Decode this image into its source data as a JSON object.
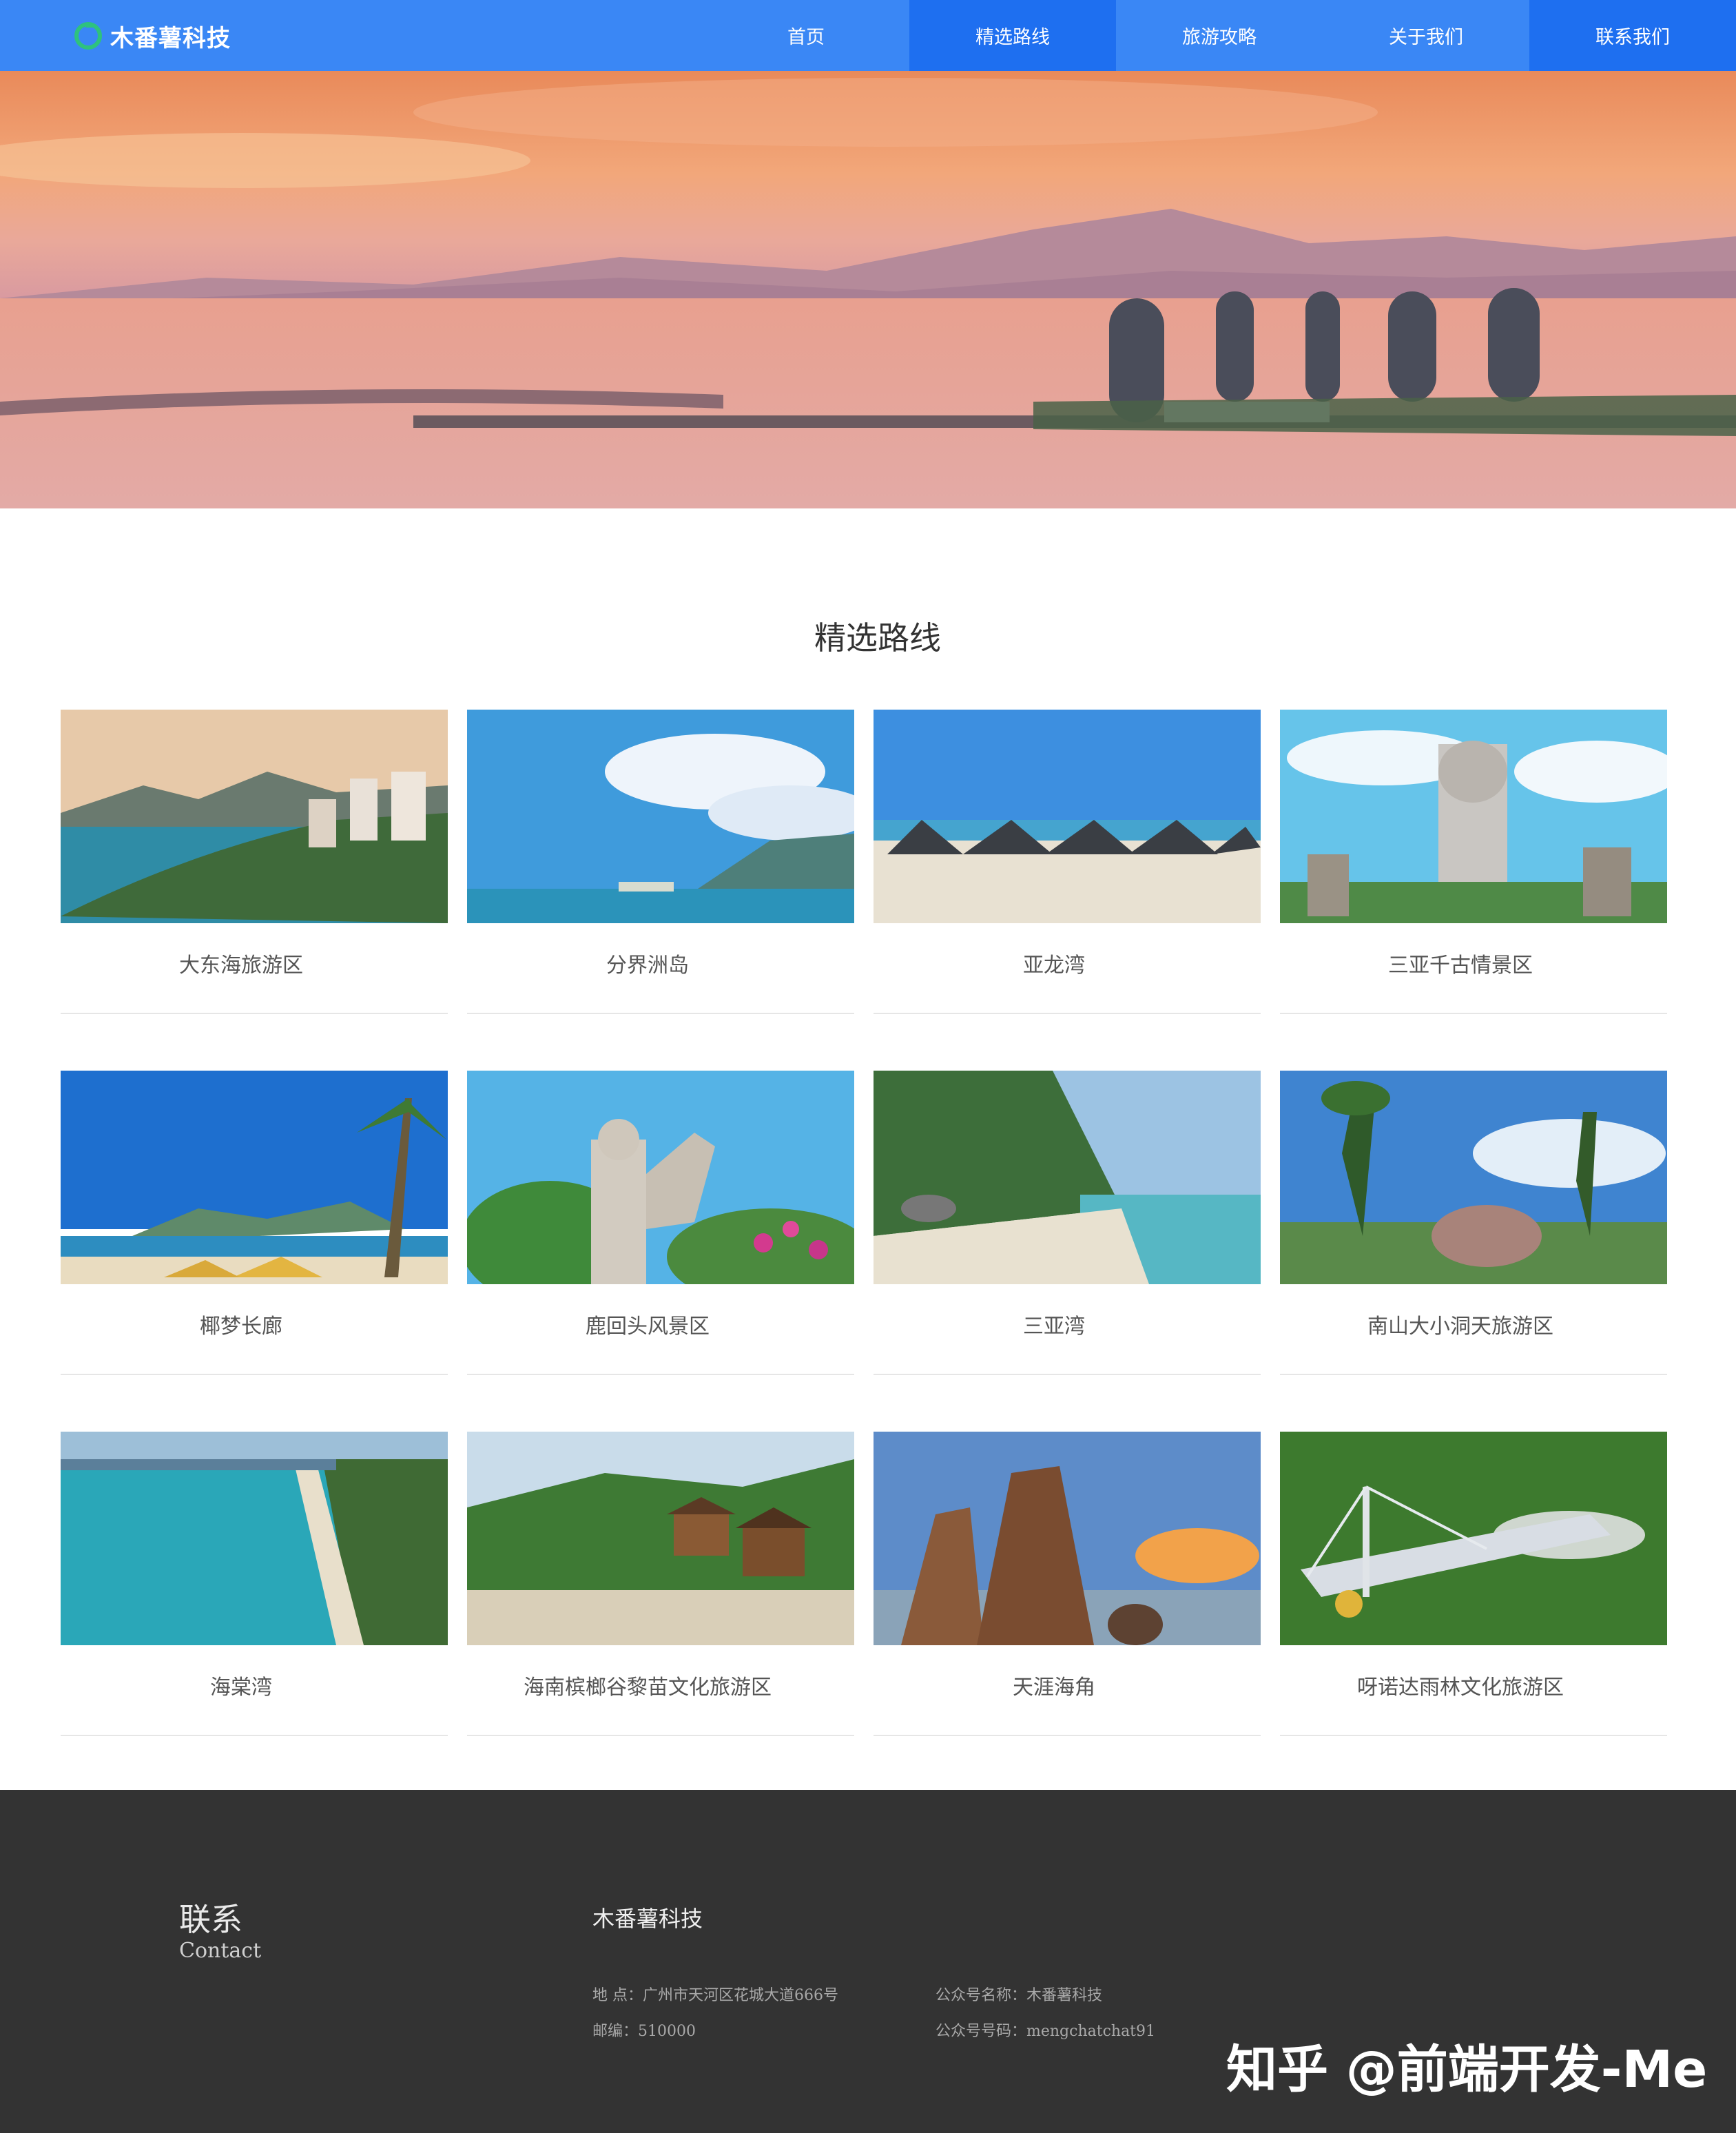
{
  "header": {
    "brand": "木番薯科技",
    "nav": [
      {
        "label": "首页"
      },
      {
        "label": "精选路线"
      },
      {
        "label": "旅游攻略"
      },
      {
        "label": "关于我们"
      },
      {
        "label": "联系我们"
      }
    ],
    "active_index": 1
  },
  "section": {
    "title": "精选路线"
  },
  "routes": [
    {
      "name": "大东海旅游区"
    },
    {
      "name": "分界洲岛"
    },
    {
      "name": "亚龙湾"
    },
    {
      "name": "三亚千古情景区"
    },
    {
      "name": "椰梦长廊"
    },
    {
      "name": "鹿回头风景区"
    },
    {
      "name": "三亚湾"
    },
    {
      "name": "南山大小洞天旅游区"
    },
    {
      "name": "海棠湾"
    },
    {
      "name": "海南槟榔谷黎苗文化旅游区"
    },
    {
      "name": "天涯海角"
    },
    {
      "name": "呀诺达雨林文化旅游区"
    }
  ],
  "footer": {
    "contact_cn": "联系",
    "contact_en": "Contact",
    "company": "木番薯科技",
    "address": "地 点：广州市天河区花城大道666号",
    "postcode": "邮编：510000",
    "wechat_name": "公众号名称：木番薯科技",
    "wechat_id": "公众号号码：mengchatchat91"
  },
  "watermark": "知乎 @前端开发-Me",
  "colors": {
    "nav_bg": "#3a87f5",
    "nav_active": "#1e6ff0",
    "footer_bg": "#333333"
  }
}
